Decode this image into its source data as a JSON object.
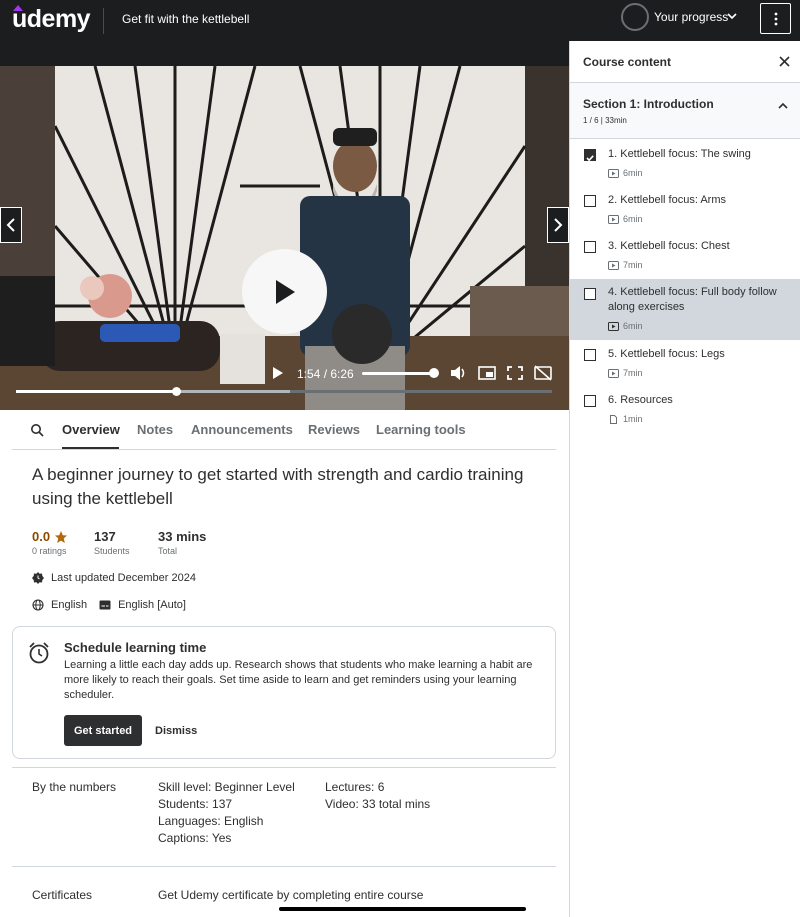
{
  "header": {
    "brand": "udemy",
    "course_title": "Get fit with the kettlebell",
    "progress_label": "Your progress"
  },
  "player": {
    "time": "1:54 / 6:26",
    "progress": 0.295,
    "volume": 0.9
  },
  "tabs": [
    "Overview",
    "Notes",
    "Announcements",
    "Reviews",
    "Learning tools"
  ],
  "overview": {
    "headline": "A beginner journey to get started with strength and cardio training using the kettlebell",
    "rating_value": "0.0",
    "rating_label": "0 ratings",
    "students_value": "137",
    "students_label": "Students",
    "total_value": "33 mins",
    "total_label": "Total",
    "last_updated": "Last updated December 2024",
    "language": "English",
    "captions": "English [Auto]"
  },
  "schedule": {
    "title": "Schedule learning time",
    "body": "Learning a little each day adds up. Research shows that students who make learning a habit are more likely to reach their goals. Set time aside to learn and get reminders using your learning scheduler.",
    "primary_button": "Get started",
    "secondary_button": "Dismiss"
  },
  "numbers": {
    "label": "By the numbers",
    "col1": [
      "Skill level: Beginner Level",
      "Students: 137",
      "Languages: English",
      "Captions: Yes"
    ],
    "col2": [
      "Lectures: 6",
      "Video: 33 total mins"
    ]
  },
  "certificates": {
    "label": "Certificates",
    "value": "Get Udemy certificate by completing entire course"
  },
  "sidebar": {
    "title": "Course content",
    "section": {
      "title": "Section 1: Introduction",
      "meta": "1 / 6 | 33min"
    },
    "lectures": [
      {
        "title": "1. Kettlebell focus: The swing",
        "duration": "6min",
        "checked": true,
        "type": "video"
      },
      {
        "title": "2. Kettlebell focus: Arms",
        "duration": "6min",
        "checked": false,
        "type": "video"
      },
      {
        "title": "3. Kettlebell focus: Chest",
        "duration": "7min",
        "checked": false,
        "type": "video"
      },
      {
        "title": "4. Kettlebell focus: Full body follow along exercises",
        "duration": "6min",
        "checked": false,
        "type": "video",
        "active": true
      },
      {
        "title": "5. Kettlebell focus: Legs",
        "duration": "7min",
        "checked": false,
        "type": "video"
      },
      {
        "title": "6. Resources",
        "duration": "1min",
        "checked": false,
        "type": "file"
      }
    ]
  },
  "colors": {
    "header_bg": "#1c1d1f",
    "brand_purple": "#a435f0",
    "star": "#b4690e",
    "active_lecture_bg": "#d1d7dc"
  }
}
